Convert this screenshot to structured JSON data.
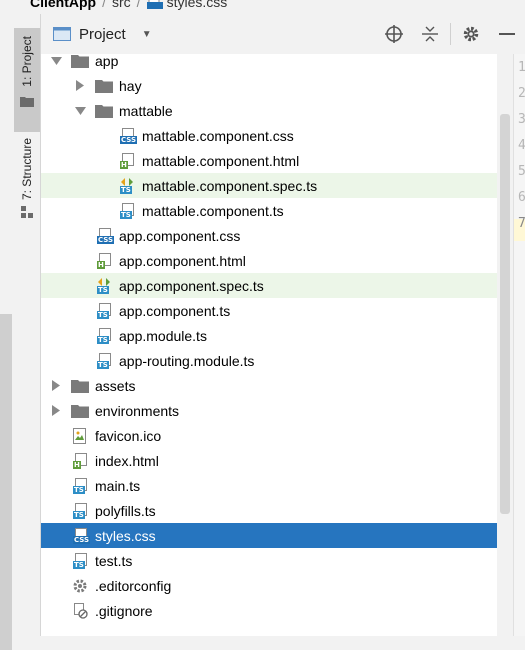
{
  "breadcrumb": {
    "root": "ClientApp",
    "folder": "src",
    "file": "styles.css"
  },
  "left_tabs": [
    {
      "label": "1: Project"
    },
    {
      "label": "7: Structure"
    }
  ],
  "header": {
    "title": "Project"
  },
  "tree": [
    {
      "label": "app",
      "kind": "folder",
      "expanded": true,
      "depth": 0
    },
    {
      "label": "hay",
      "kind": "folder",
      "expanded": false,
      "depth": 1
    },
    {
      "label": "mattable",
      "kind": "folder",
      "expanded": true,
      "depth": 1
    },
    {
      "label": "mattable.component.css",
      "kind": "css",
      "depth": 2
    },
    {
      "label": "mattable.component.html",
      "kind": "html",
      "depth": 2
    },
    {
      "label": "mattable.component.spec.ts",
      "kind": "spec",
      "depth": 2,
      "highlight": true
    },
    {
      "label": "mattable.component.ts",
      "kind": "ts",
      "depth": 2
    },
    {
      "label": "app.component.css",
      "kind": "css",
      "depth": 1
    },
    {
      "label": "app.component.html",
      "kind": "html",
      "depth": 1
    },
    {
      "label": "app.component.spec.ts",
      "kind": "spec",
      "depth": 1,
      "highlight": true
    },
    {
      "label": "app.component.ts",
      "kind": "ts",
      "depth": 1
    },
    {
      "label": "app.module.ts",
      "kind": "ts",
      "depth": 1
    },
    {
      "label": "app-routing.module.ts",
      "kind": "ts",
      "depth": 1
    },
    {
      "label": "assets",
      "kind": "folder",
      "expanded": false,
      "depth": 0
    },
    {
      "label": "environments",
      "kind": "folder",
      "expanded": false,
      "depth": 0
    },
    {
      "label": "favicon.ico",
      "kind": "ico",
      "depth": 0
    },
    {
      "label": "index.html",
      "kind": "html",
      "depth": 0
    },
    {
      "label": "main.ts",
      "kind": "ts",
      "depth": 0
    },
    {
      "label": "polyfills.ts",
      "kind": "ts",
      "depth": 0
    },
    {
      "label": "styles.css",
      "kind": "css",
      "depth": 0,
      "selected": true
    },
    {
      "label": "test.ts",
      "kind": "ts",
      "depth": 0
    },
    {
      "label": ".editorconfig",
      "kind": "config",
      "depth": -1
    },
    {
      "label": ".gitignore",
      "kind": "gitignore",
      "depth": -1
    }
  ],
  "line_numbers": [
    "1",
    "2",
    "3",
    "4",
    "5",
    "6",
    "7"
  ],
  "colors": {
    "selection": "#2675bf",
    "highlight": "#ecf6e8",
    "css_badge": "#1f6fb3",
    "ts_badge": "#2d8ec6",
    "html_badge": "#5f9c3a"
  },
  "icons": {
    "locate": "crosshair-icon",
    "collapse": "collapse-all-icon",
    "settings": "gear-icon",
    "hide": "minimize-icon"
  }
}
